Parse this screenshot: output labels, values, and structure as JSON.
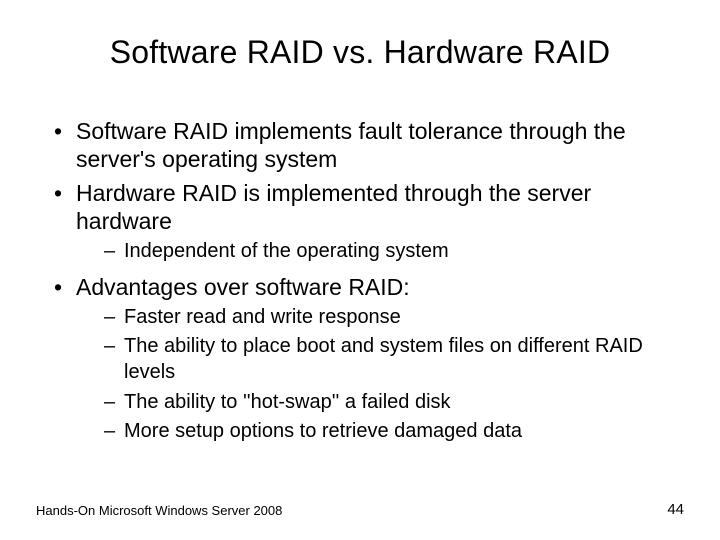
{
  "title": "Software RAID vs. Hardware RAID",
  "bullets": [
    {
      "text": "Software RAID implements fault tolerance through the server's operating system"
    },
    {
      "text": "Hardware RAID is implemented through the server hardware",
      "sub": [
        {
          "text": "Independent of the operating system"
        }
      ]
    },
    {
      "text": "Advantages over software RAID:",
      "sub": [
        {
          "text": "Faster read and write response"
        },
        {
          "text": "The ability to place boot and system files on different RAID levels"
        },
        {
          "text": "The ability to ''hot-swap'' a failed disk"
        },
        {
          "text": "More setup options to retrieve damaged data"
        }
      ]
    }
  ],
  "footer": {
    "source": "Hands-On Microsoft Windows Server 2008",
    "page": "44"
  }
}
